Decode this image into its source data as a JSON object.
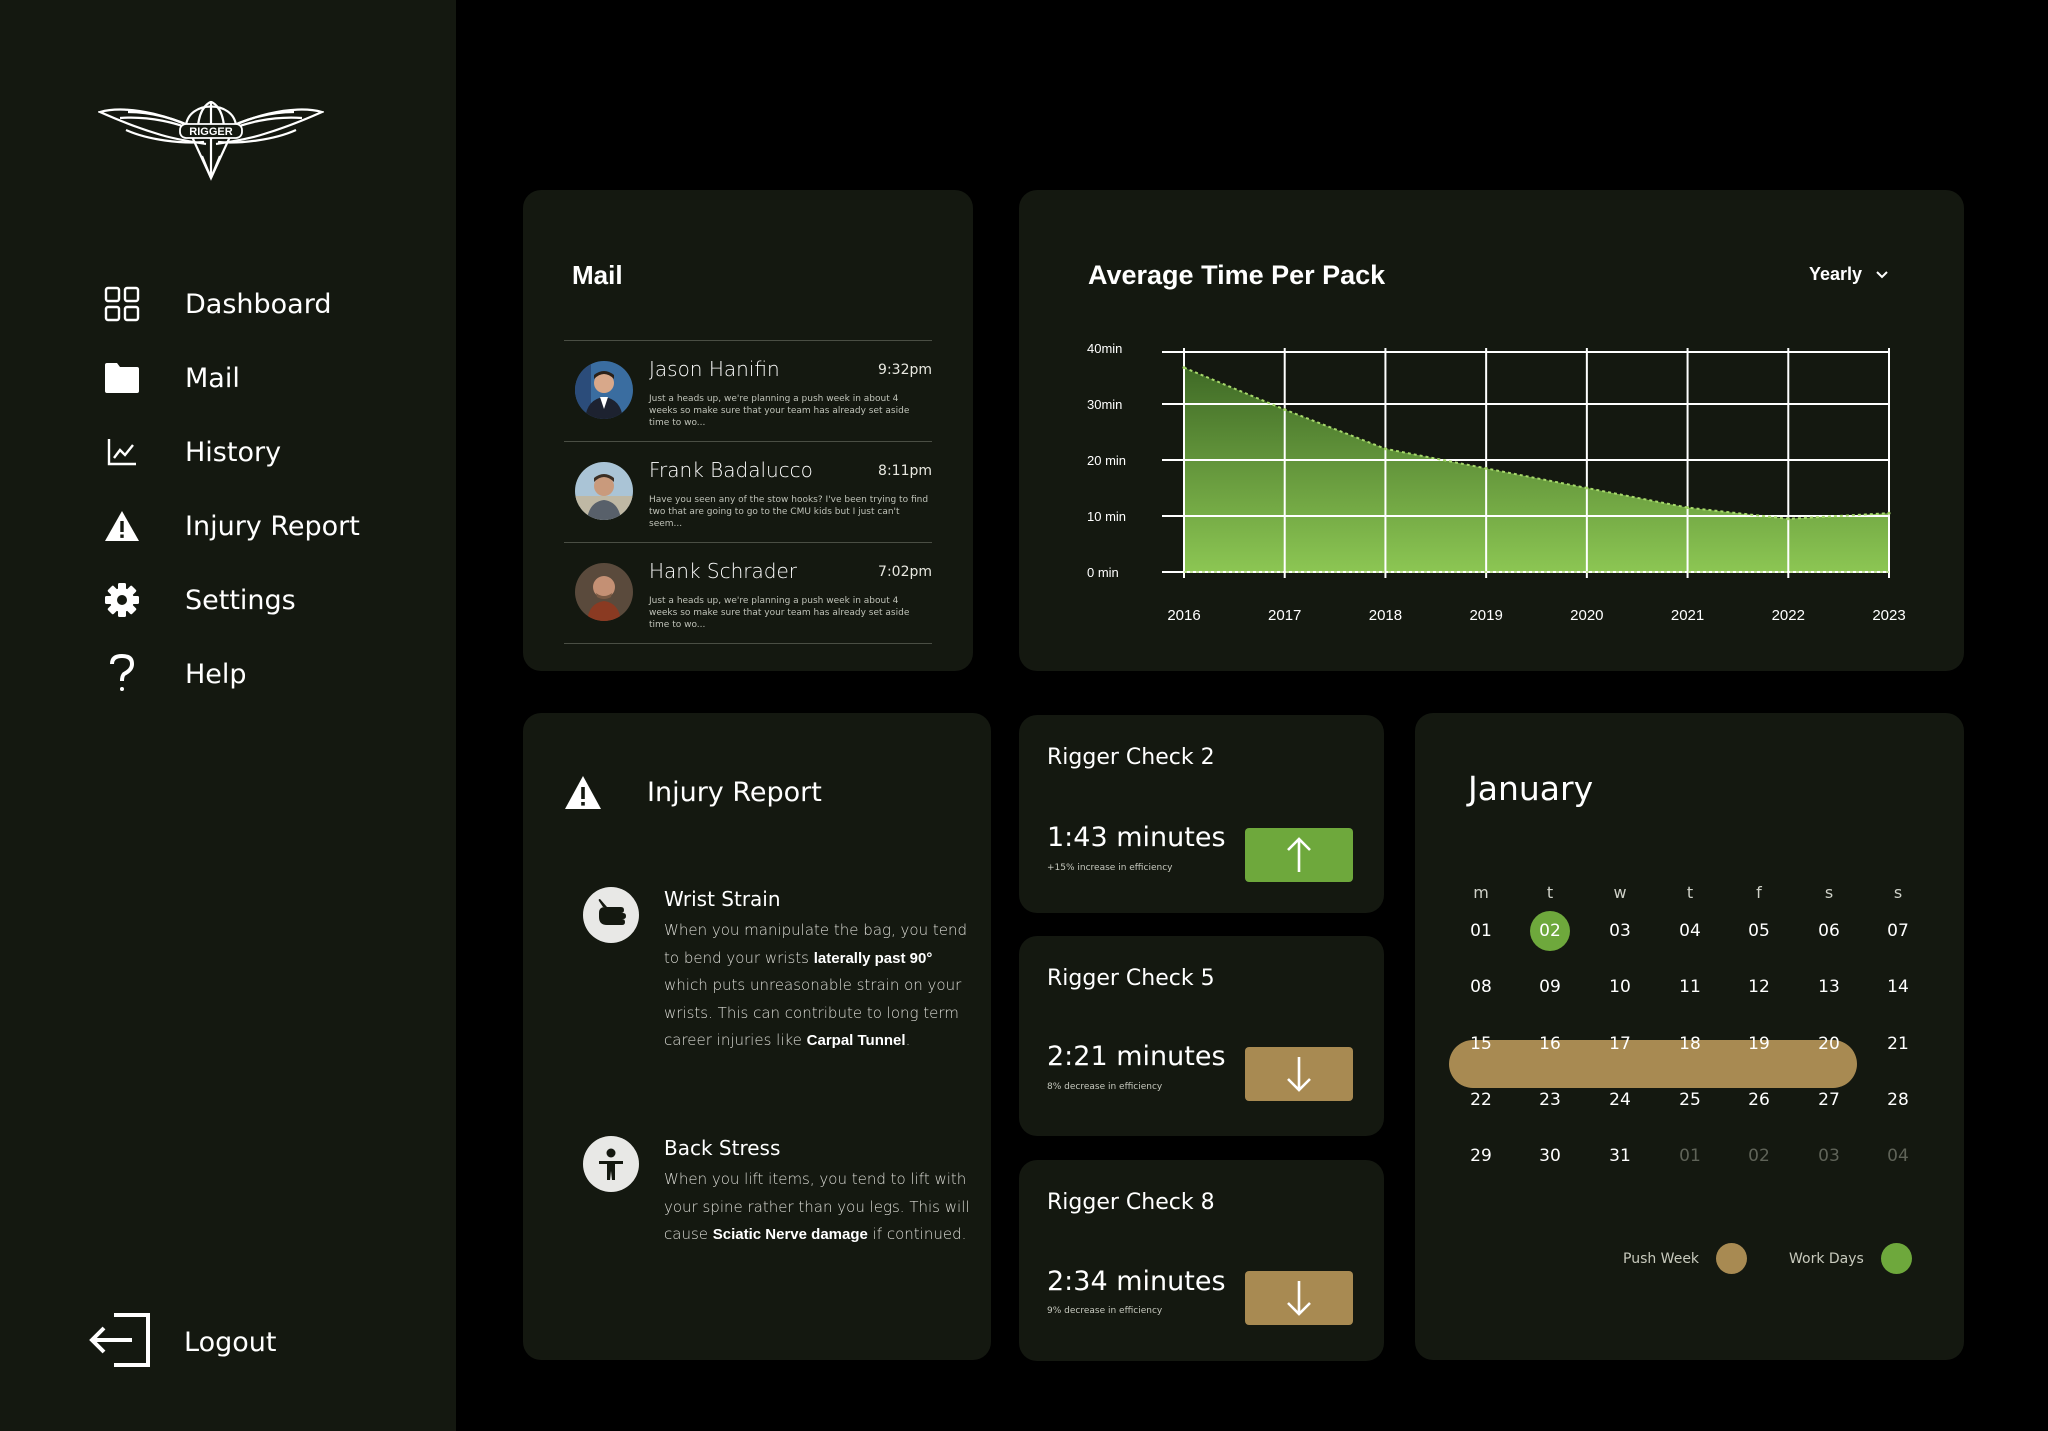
{
  "app": {
    "logo_text": "RIGGER"
  },
  "sidebar": {
    "items": [
      {
        "label": "Dashboard",
        "icon": "grid-icon"
      },
      {
        "label": "Mail",
        "icon": "folder-icon"
      },
      {
        "label": "History",
        "icon": "line-chart-icon"
      },
      {
        "label": "Injury Report",
        "icon": "warning-icon"
      },
      {
        "label": "Settings",
        "icon": "gear-icon"
      },
      {
        "label": "Help",
        "icon": "question-icon"
      }
    ],
    "logout_label": "Logout"
  },
  "mail": {
    "title": "Mail",
    "messages": [
      {
        "sender": "Jason Hanifin",
        "time": "9:32pm",
        "preview": "Just a heads up, we're planning a push week in about 4 weeks so make sure that your team has already set aside time to wo..."
      },
      {
        "sender": "Frank Badalucco",
        "time": "8:11pm",
        "preview": "Have you seen any of the stow hooks? I've been trying to find two that are going to go to the CMU kids but I just can't seem..."
      },
      {
        "sender": "Hank Schrader",
        "time": "7:02pm",
        "preview": "Just a heads up, we're planning a push week in about 4 weeks so make sure that your team has already set aside time to wo..."
      }
    ]
  },
  "chart": {
    "title": "Average Time Per Pack",
    "period_select": "Yearly"
  },
  "chart_data": {
    "type": "area",
    "title": "Average Time Per Pack",
    "x": [
      "2016",
      "2017",
      "2018",
      "2019",
      "2020",
      "2021",
      "2022",
      "2023"
    ],
    "series": [
      {
        "values": [
          36.5,
          29,
          22,
          18.5,
          15,
          11.5,
          9.5,
          10.5
        ]
      }
    ],
    "y_ticks": [
      "0 min",
      "10 min",
      "20 min",
      "30min",
      "40min"
    ],
    "ylim": [
      0,
      40
    ],
    "grid": true,
    "fill_color": "#7db442"
  },
  "injury": {
    "title": "Injury Report",
    "items": [
      {
        "name": "Wrist Strain",
        "icon": "hand-icon",
        "desc_1": "When you manipulate the bag, you tend to bend your wrists ",
        "bold_1": "laterally past 90°",
        "desc_2": " which puts unreasonable strain on your wrists. This can contribute to long term career injuries like ",
        "bold_2": "Carpal Tunnel",
        "desc_3": "."
      },
      {
        "name": "Back Stress",
        "icon": "person-icon",
        "desc_1": "When you lift items, you tend to lift with your spine rather than you legs. This will cause ",
        "bold_1": "Sciatic Nerve damage",
        "desc_2": " if continued."
      }
    ]
  },
  "checks": [
    {
      "title": "Rigger Check 2",
      "value": "1:43 minutes",
      "sub": "+15% increase in efficiency",
      "trend": "up"
    },
    {
      "title": "Rigger Check 5",
      "value": "2:21 minutes",
      "sub": "8% decrease in efficiency",
      "trend": "down"
    },
    {
      "title": "Rigger Check 8",
      "value": "2:34 minutes",
      "sub": "9% decrease in efficiency",
      "trend": "down"
    }
  ],
  "calendar": {
    "month": "January",
    "weekdays": [
      "m",
      "t",
      "w",
      "t",
      "f",
      "s",
      "s"
    ],
    "weeks": [
      [
        "01",
        "02",
        "03",
        "04",
        "05",
        "06",
        "07"
      ],
      [
        "08",
        "09",
        "10",
        "11",
        "12",
        "13",
        "14"
      ],
      [
        "15",
        "16",
        "17",
        "18",
        "19",
        "20",
        "21"
      ],
      [
        "22",
        "23",
        "24",
        "25",
        "26",
        "27",
        "28"
      ],
      [
        "29",
        "30",
        "31",
        "01",
        "02",
        "03",
        "04"
      ]
    ],
    "work_day": "02",
    "push_week": [
      "15",
      "16",
      "17",
      "18",
      "19",
      "20"
    ],
    "legend": {
      "push_week": "Push Week",
      "work_days": "Work Days"
    }
  },
  "colors": {
    "background": "#000000",
    "panel": "#141810",
    "green": "#6ea83c",
    "gold": "#a88a52"
  }
}
